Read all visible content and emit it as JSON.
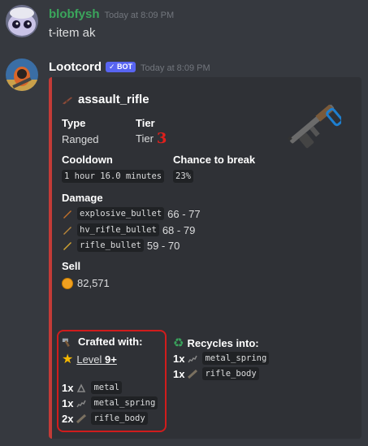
{
  "message1": {
    "author": "blobfysh",
    "timestamp": "Today at 8:09 PM",
    "text": "t-item ak",
    "author_color": "#3ba55c"
  },
  "message2": {
    "author": "Lootcord",
    "bot_badge": "✓ BOT",
    "timestamp": "Today at 8:09 PM"
  },
  "embed": {
    "accent_color": "#c33b37",
    "title": "assault_rifle",
    "type_label": "Type",
    "type_value": "Ranged",
    "tier_label": "Tier",
    "tier_text": "Tier",
    "tier_number": "3",
    "cooldown_label": "Cooldown",
    "cooldown_value": "1 hour 16.0 minutes",
    "break_label": "Chance to break",
    "break_value": "23%",
    "damage_label": "Damage",
    "damage": [
      {
        "item": "explosive_bullet",
        "range": "66 - 77"
      },
      {
        "item": "hv_rifle_bullet",
        "range": "68 - 79"
      },
      {
        "item": "rifle_bullet",
        "range": "59 - 70"
      }
    ],
    "sell_label": "Sell",
    "sell_value": "82,571",
    "crafted_label": "Crafted with:",
    "level_text": "Level ",
    "level_value": "9+",
    "crafted": [
      {
        "qty": "1x",
        "item": "metal"
      },
      {
        "qty": "1x",
        "item": "metal_spring"
      },
      {
        "qty": "2x",
        "item": "rifle_body"
      }
    ],
    "recycles_label": "Recycles into:",
    "recycles": [
      {
        "qty": "1x",
        "item": "metal_spring"
      },
      {
        "qty": "1x",
        "item": "rifle_body"
      }
    ]
  }
}
